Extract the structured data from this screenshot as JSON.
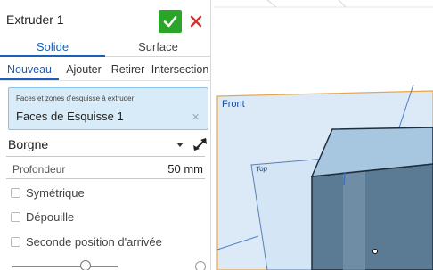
{
  "feature": {
    "title": "Extruder 1",
    "ok_label": "✔",
    "cancel_label": "✕"
  },
  "body_type": {
    "tabs": [
      "Solide",
      "Surface"
    ],
    "selected": "Solide"
  },
  "operation": {
    "tabs": [
      "Nouveau",
      "Ajouter",
      "Retirer",
      "Intersection"
    ],
    "selected": "Nouveau"
  },
  "selection": {
    "caption": "Faces et zones d'esquisse à extruder",
    "value": "Faces de Esquisse 1",
    "clear_label": "✕"
  },
  "end_type": {
    "value": "Borgne"
  },
  "depth": {
    "label": "Profondeur",
    "value": "50 mm"
  },
  "options": {
    "symmetric": {
      "label": "Symétrique",
      "checked": false
    },
    "draft": {
      "label": "Dépouille",
      "checked": false
    },
    "second_end": {
      "label": "Seconde position d'arrivée",
      "checked": false
    }
  },
  "viewport": {
    "front_plane_label": "Front",
    "top_plane_label": "Top"
  },
  "colors": {
    "accent": "#1d5fb8",
    "ok_green": "#2aa52a",
    "cancel_red": "#d0312d",
    "selection_bg": "#d7ebf8",
    "plane_fill": "#dceaf7",
    "body_front": "#5a7b93",
    "body_top": "#a7c6e0"
  },
  "icons": [
    "check-icon",
    "close-icon",
    "caret-down-icon",
    "flip-direction-icon",
    "help-icon"
  ]
}
